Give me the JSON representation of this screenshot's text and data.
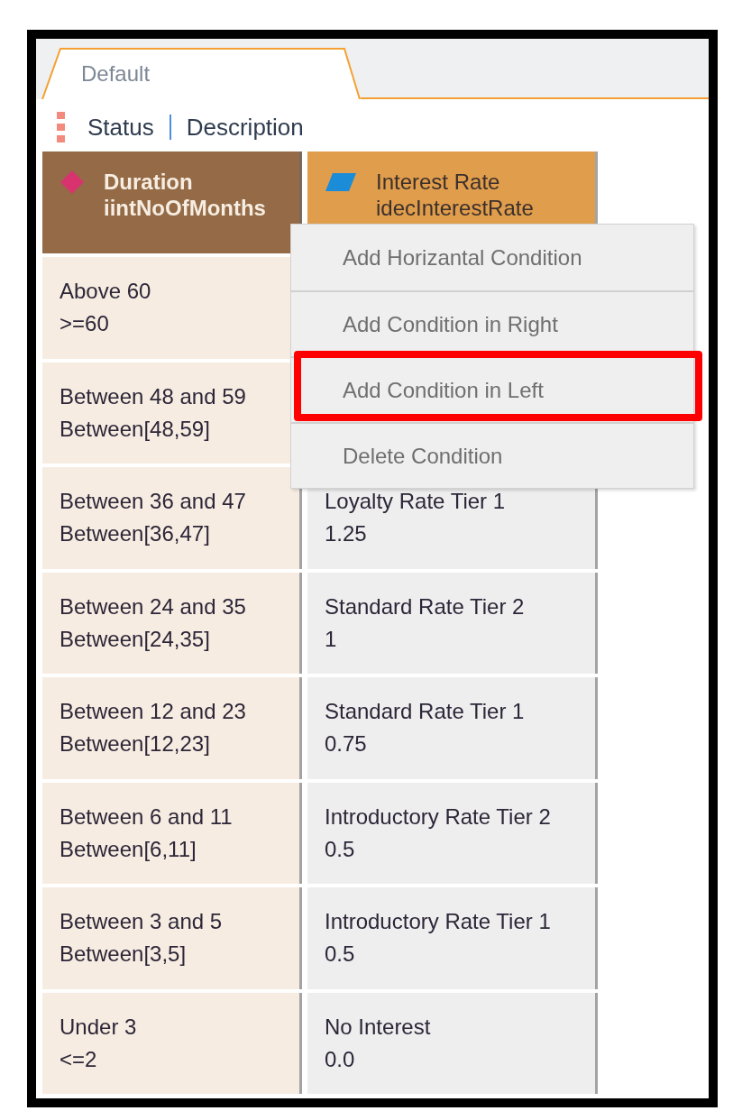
{
  "tabs": [
    {
      "label": "Default",
      "selected": true
    }
  ],
  "toolbar": {
    "items": [
      "Status",
      "Description"
    ]
  },
  "table": {
    "columns": [
      {
        "kind": "condition",
        "title": "Duration",
        "field": "iintNoOfMonths"
      },
      {
        "kind": "action",
        "title": "Interest Rate",
        "field": "idecInterestRate"
      }
    ],
    "rows": [
      {
        "condition": {
          "label": "Above 60",
          "value": ">=60"
        }
      },
      {
        "condition": {
          "label": "Between 48 and 59",
          "value": "Between[48,59]"
        }
      },
      {
        "condition": {
          "label": "Between 36 and 47",
          "value": "Between[36,47]"
        },
        "result": {
          "label": "Loyalty Rate Tier 1",
          "value": "1.25"
        }
      },
      {
        "condition": {
          "label": "Between 24 and 35",
          "value": "Between[24,35]"
        },
        "result": {
          "label": "Standard Rate Tier 2",
          "value": "1"
        }
      },
      {
        "condition": {
          "label": "Between 12 and 23",
          "value": "Between[12,23]"
        },
        "result": {
          "label": "Standard Rate Tier 1",
          "value": "0.75"
        }
      },
      {
        "condition": {
          "label": "Between 6 and 11",
          "value": "Between[6,11]"
        },
        "result": {
          "label": "Introductory Rate Tier 2",
          "value": "0.5"
        }
      },
      {
        "condition": {
          "label": "Between 3 and 5",
          "value": "Between[3,5]"
        },
        "result": {
          "label": "Introductory Rate Tier 1",
          "value": "0.5"
        }
      },
      {
        "condition": {
          "label": "Under 3",
          "value": "<=2"
        },
        "result": {
          "label": "No Interest",
          "value": "0.0"
        }
      }
    ]
  },
  "context_menu": {
    "items": [
      {
        "label": "Add Horizantal Condition",
        "highlighted": false
      },
      {
        "label": "Add Condition in Right",
        "highlighted": false
      },
      {
        "label": "Add Condition in Left",
        "highlighted": true
      },
      {
        "label": "Delete Condition",
        "highlighted": false
      }
    ]
  }
}
